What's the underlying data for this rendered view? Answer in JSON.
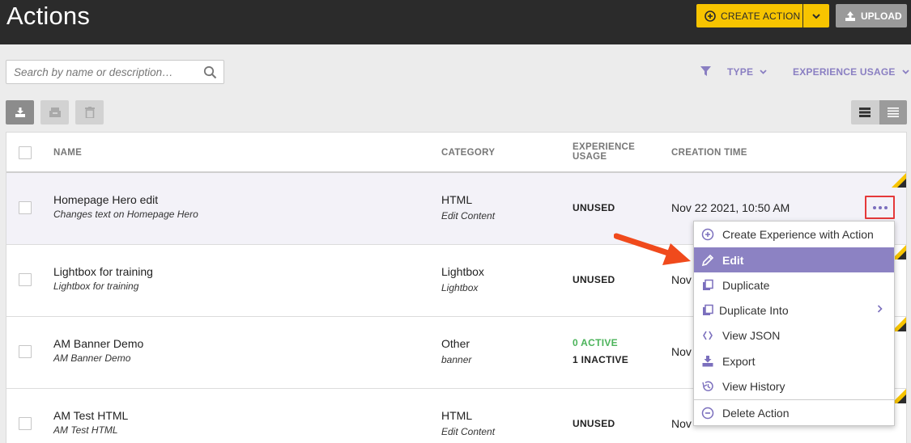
{
  "header": {
    "title": "Actions",
    "create_label": "CREATE ACTION",
    "upload_label": "UPLOAD"
  },
  "search": {
    "placeholder": "Search by name or description…"
  },
  "filters": {
    "type_label": "TYPE",
    "usage_label": "EXPERIENCE USAGE"
  },
  "table": {
    "columns": {
      "name": "NAME",
      "category": "CATEGORY",
      "usage_line1": "EXPERIENCE",
      "usage_line2": "USAGE",
      "created": "CREATION TIME"
    },
    "rows": [
      {
        "name": "Homepage Hero edit",
        "description": "Changes text on Homepage Hero",
        "category": "HTML",
        "subcategory": "Edit Content",
        "usage": "UNUSED",
        "created": "Nov 22 2021, 10:50 AM"
      },
      {
        "name": "Lightbox for training",
        "description": "Lightbox for training",
        "category": "Lightbox",
        "subcategory": "Lightbox",
        "usage": "UNUSED",
        "created": "Nov"
      },
      {
        "name": "AM Banner Demo",
        "description": "AM Banner Demo",
        "category": "Other",
        "subcategory": "banner",
        "usage_active": "0 ACTIVE",
        "usage_inactive": "1 INACTIVE",
        "created": "Nov"
      },
      {
        "name": "AM Test HTML",
        "description": "AM Test HTML",
        "category": "HTML",
        "subcategory": "Edit Content",
        "usage": "UNUSED",
        "created": "Nov"
      }
    ]
  },
  "context_menu": {
    "items": [
      {
        "label": "Create Experience with Action",
        "icon": "plus-circle-icon"
      },
      {
        "label": "Edit",
        "icon": "pencil-icon"
      },
      {
        "label": "Duplicate",
        "icon": "duplicate-icon"
      },
      {
        "label": "Duplicate Into",
        "icon": "duplicate-into-icon"
      },
      {
        "label": "View JSON",
        "icon": "code-braces-icon"
      },
      {
        "label": "Export",
        "icon": "export-icon"
      },
      {
        "label": "View History",
        "icon": "history-icon"
      },
      {
        "label": "Delete Action",
        "icon": "minus-circle-icon"
      }
    ],
    "active_item": "Edit"
  },
  "colors": {
    "accent": "#8c82c3",
    "brand_yellow": "#f7c400",
    "header_bg": "#2b2b2b",
    "active_green": "#4bb35a",
    "annotation_red": "#e5393a"
  }
}
